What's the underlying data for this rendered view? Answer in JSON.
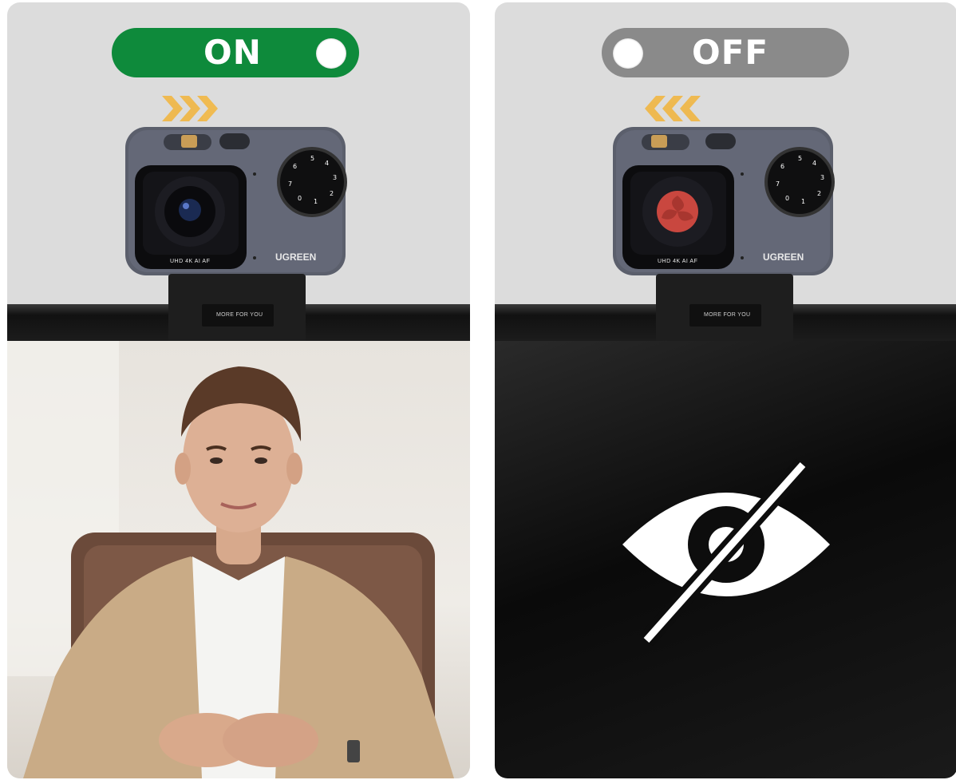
{
  "panels": [
    {
      "state_label": "ON",
      "state": "on",
      "toggle_color": "#0e8a3b",
      "arrow_direction": "right",
      "lens": "open",
      "scene": "person-on-camera"
    },
    {
      "state_label": "OFF",
      "state": "off",
      "toggle_color": "#8a8a8a",
      "arrow_direction": "left",
      "lens": "privacy-shutter-closed",
      "scene": "blocked-view",
      "scene_icon": "eye-slash-icon"
    }
  ],
  "camera": {
    "brand": "UGREEN",
    "specs": "UHD  4K  AI  AF",
    "mount_text": "MORE FOR YOU",
    "dial_numbers": [
      "5",
      "4",
      "3",
      "2",
      "1",
      "0",
      "7",
      "6"
    ]
  },
  "colors": {
    "arrow": "#f0b84a",
    "shutter_red": "#c9473f",
    "panel_bg": "#dcdcdc"
  }
}
